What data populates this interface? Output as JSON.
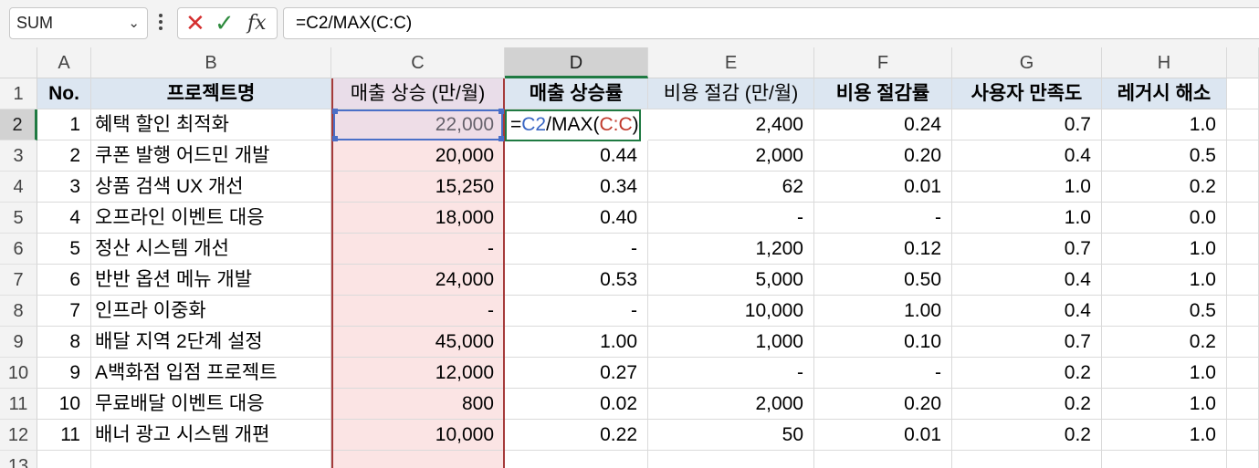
{
  "formula_bar": {
    "name_box": "SUM",
    "formula": "=C2/MAX(C:C)",
    "cancel_icon": "x-icon",
    "enter_icon": "check-icon",
    "fx_label": "fx",
    "colors": {
      "cancel": "#d42f2f",
      "enter": "#2e8b3e"
    }
  },
  "column_headers": [
    "A",
    "B",
    "C",
    "D",
    "E",
    "F",
    "G",
    "H"
  ],
  "row_numbers": [
    "1",
    "2",
    "3",
    "4",
    "5",
    "6",
    "7",
    "8",
    "9",
    "10",
    "11",
    "12",
    "13"
  ],
  "header_row": [
    "No.",
    "프로젝트명",
    "매출 상승 (만/월)",
    "매출 상승률",
    "비용 절감 (만/월)",
    "비용 절감률",
    "사용자 만족도",
    "레거시 해소"
  ],
  "editing_cell": {
    "prefix": "=",
    "ref1": "C2",
    "middle": "/MAX(",
    "ref2": "C:C",
    "suffix": ")"
  },
  "rows": [
    [
      "1",
      "혜택 할인 최적화",
      "22,000",
      "",
      "2,400",
      "0.24",
      "0.7",
      "1.0"
    ],
    [
      "2",
      "쿠폰 발행 어드민 개발",
      "20,000",
      "0.44",
      "2,000",
      "0.20",
      "0.4",
      "0.5"
    ],
    [
      "3",
      "상품 검색 UX 개선",
      "15,250",
      "0.34",
      "62",
      "0.01",
      "1.0",
      "0.2"
    ],
    [
      "4",
      "오프라인 이벤트 대응",
      "18,000",
      "0.40",
      "-",
      "-",
      "1.0",
      "0.0"
    ],
    [
      "5",
      "정산 시스템 개선",
      "-",
      "-",
      "1,200",
      "0.12",
      "0.7",
      "1.0"
    ],
    [
      "6",
      "반반 옵션 메뉴 개발",
      "24,000",
      "0.53",
      "5,000",
      "0.50",
      "0.4",
      "1.0"
    ],
    [
      "7",
      "인프라 이중화",
      "-",
      "-",
      "10,000",
      "1.00",
      "0.4",
      "0.5"
    ],
    [
      "8",
      "배달 지역 2단계 설정",
      "45,000",
      "1.00",
      "1,000",
      "0.10",
      "0.7",
      "0.2"
    ],
    [
      "9",
      "A백화점 입점 프로젝트",
      "12,000",
      "0.27",
      "-",
      "-",
      "0.2",
      "1.0"
    ],
    [
      "10",
      "무료배달 이벤트 대응",
      "800",
      "0.02",
      "2,000",
      "0.20",
      "0.2",
      "1.0"
    ],
    [
      "11",
      "배너 광고 시스템 개편",
      "10,000",
      "0.22",
      "50",
      "0.01",
      "0.2",
      "1.0"
    ]
  ],
  "colors": {
    "header_fill": "#dce6f1",
    "highlight_fill": "#fbe4e4",
    "selection_green": "#1f7a42",
    "ref_blue": "#4a6fc8",
    "ref_red": "#c0392b"
  }
}
